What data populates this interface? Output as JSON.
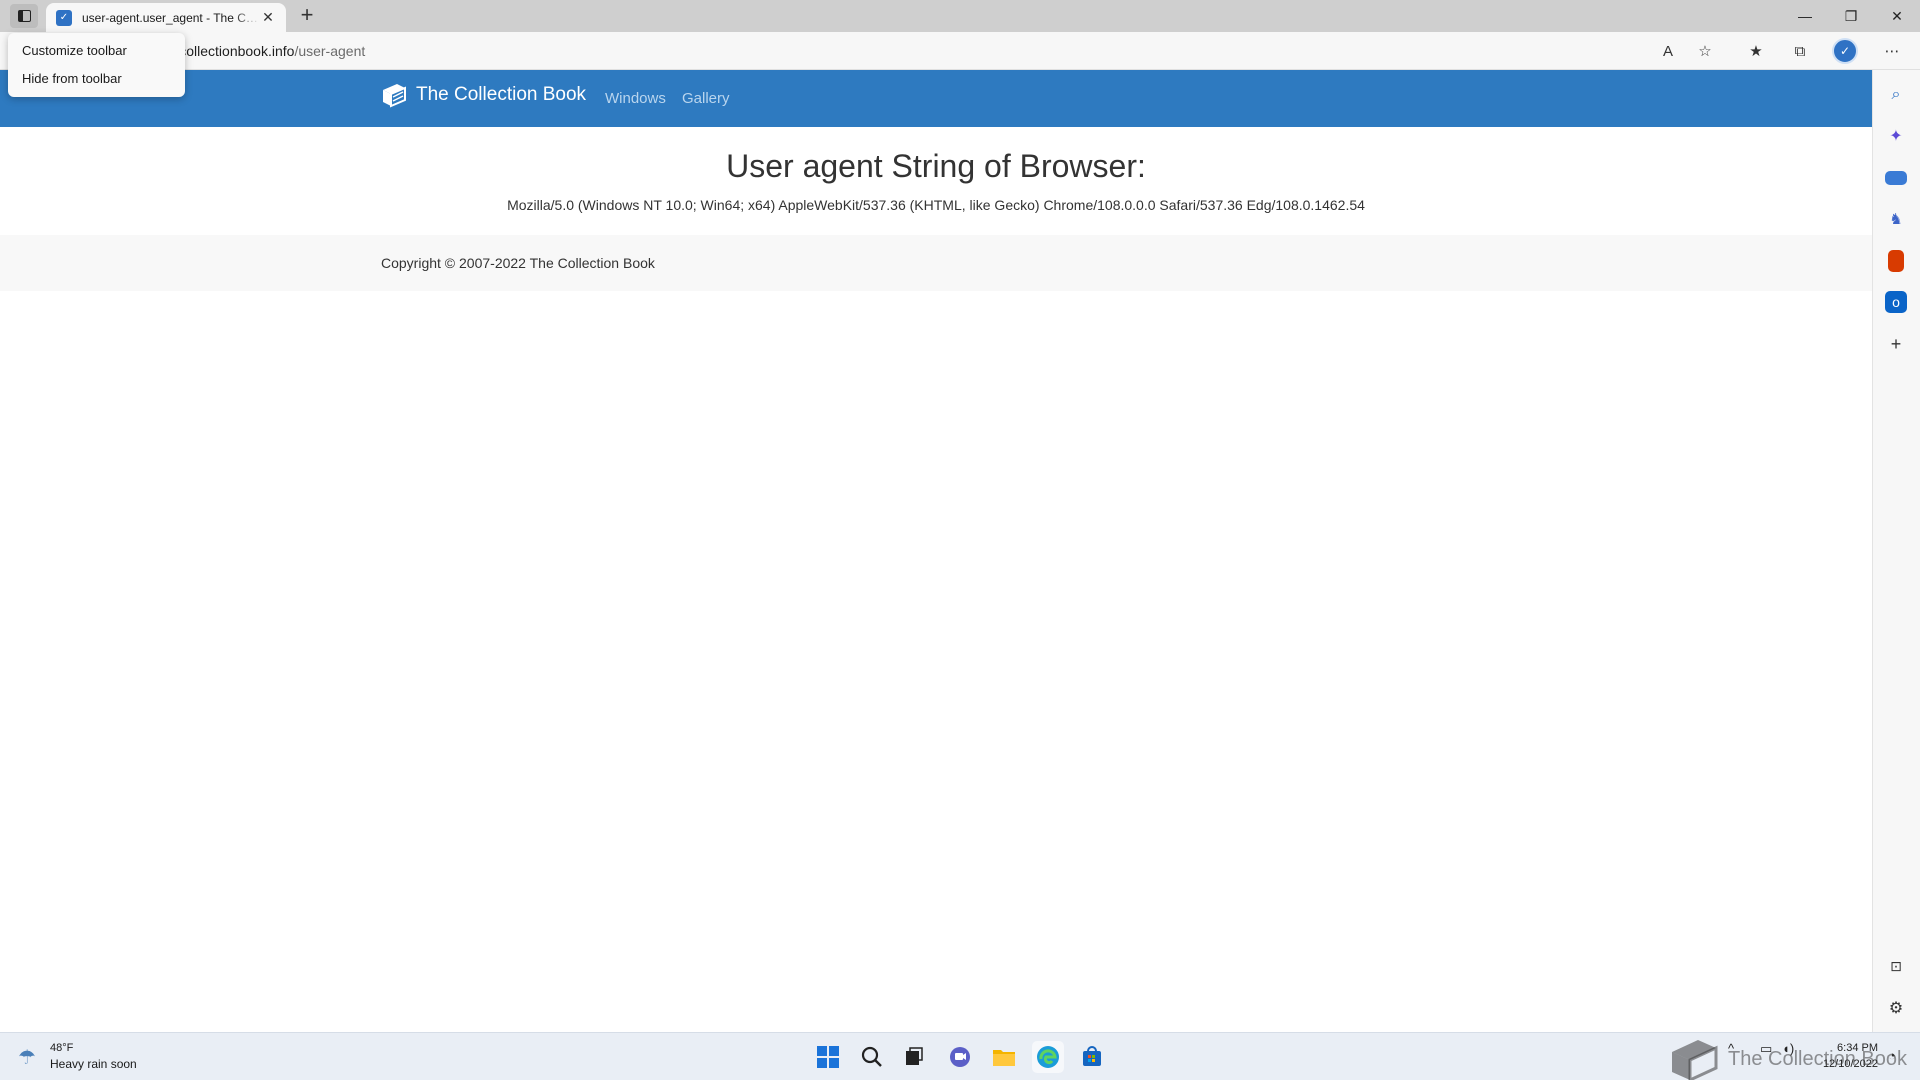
{
  "browser": {
    "tab_title": "user-agent.user_agent - The Collection Book",
    "new_tab_symbol": "+",
    "url_host": "//thecollectionbook.info",
    "url_path": "/user-agent"
  },
  "context_menu": {
    "items": [
      {
        "label": "Customize toolbar"
      },
      {
        "label": "Hide from toolbar"
      }
    ]
  },
  "site": {
    "brand": "The Collection Book",
    "nav": [
      {
        "label": "Windows"
      },
      {
        "label": "Gallery"
      }
    ],
    "heading": "User agent String of Browser:",
    "user_agent": "Mozilla/5.0 (Windows NT 10.0; Win64; x64) AppleWebKit/537.36 (KHTML, like Gecko) Chrome/108.0.0.0 Safari/537.36 Edg/108.0.1462.54",
    "copyright": "Copyright © 2007-2022 The Collection Book"
  },
  "taskbar": {
    "weather_temp": "48°F",
    "weather_desc": "Heavy rain soon",
    "time": "6:34 PM",
    "date": "12/10/2022"
  },
  "watermark": "The Collection Book",
  "colors": {
    "header_blue": "#2e7ac0",
    "nav_link": "#b9d5ee",
    "tabstrip": "#cfcfcf"
  }
}
